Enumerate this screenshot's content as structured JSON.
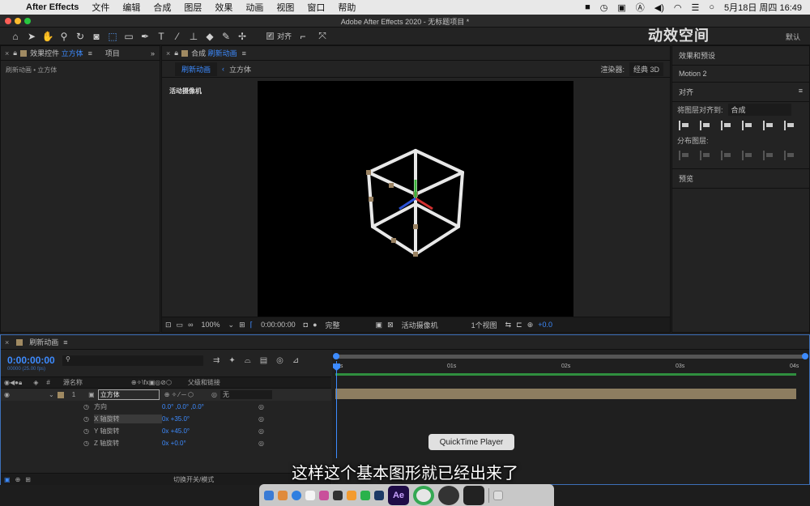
{
  "menubar": {
    "app": "After Effects",
    "items": [
      "文件",
      "编辑",
      "合成",
      "图层",
      "效果",
      "动画",
      "视图",
      "窗口",
      "帮助"
    ],
    "date_time": "5月18日 周四 16:49"
  },
  "window": {
    "title": "Adobe After Effects 2020 - 无标题项目 *"
  },
  "toolbar": {
    "align_label": "对齐",
    "workspace": "默认"
  },
  "effects_panel": {
    "tab_prefix": "效果控件",
    "tab_layer": "立方体",
    "tab_project": "项目",
    "subtitle": "刷新动画 • 立方体"
  },
  "comp_panel": {
    "tab_prefix": "合成",
    "tab_name": "刷新动画",
    "crumb_comp": "刷新动画",
    "crumb_layer": "立方体",
    "renderer_label": "渲染器:",
    "renderer_value": "经典 3D",
    "camera_label": "活动摄像机",
    "zoom": "100%",
    "time": "0:00:00:00",
    "quality": "完整",
    "view_camera": "活动摄像机",
    "view_count": "1个视图",
    "exposure": "+0.0"
  },
  "right_panel": {
    "effects_presets": "效果和预设",
    "motion": "Motion 2",
    "align_title": "对齐",
    "align_to_label": "将图层对齐到:",
    "align_to_value": "合成",
    "distribute": "分布图层:",
    "preview": "预览"
  },
  "timeline": {
    "tab": "刷新动画",
    "timecode": "0:00:00:00",
    "fps": "00000 (25.00 fps)",
    "col_source": "源名称",
    "col_parent": "父级和链接",
    "layer_num": "1",
    "layer_name": "立方体",
    "parent_value": "无",
    "props": [
      {
        "name": "方向",
        "value": "0.0° ,0.0° ,0.0°"
      },
      {
        "name": "X 轴旋转",
        "value": "0x +35.0°"
      },
      {
        "name": "Y 轴旋转",
        "value": "0x +45.0°"
      },
      {
        "name": "Z 轴旋转",
        "value": "0x +0.0°"
      }
    ],
    "ruler": [
      "0s",
      "01s",
      "02s",
      "03s",
      "04s"
    ],
    "switch_mode": "切换开关/模式"
  },
  "tooltip": "QuickTime Player",
  "subtitle": "这样这个基本图形就已经出来了",
  "watermark": "动效空间",
  "dock": {
    "ae": "Ae"
  }
}
